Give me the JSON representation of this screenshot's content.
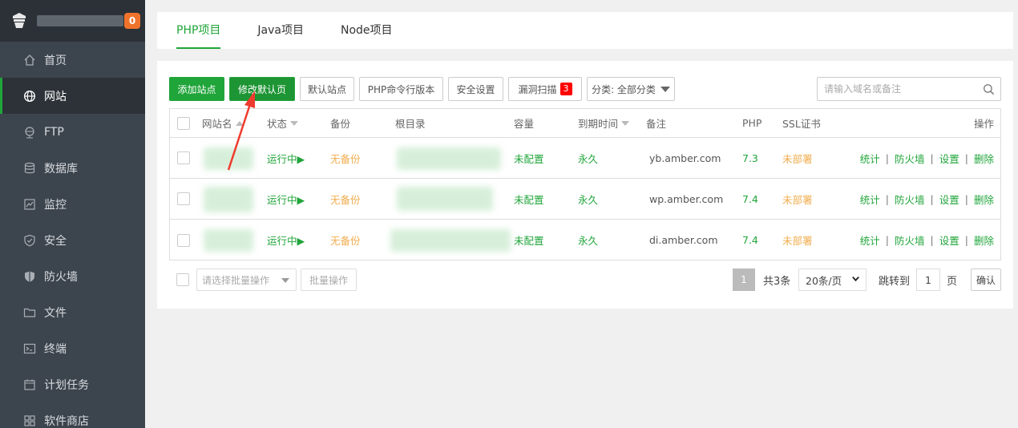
{
  "sidebar": {
    "badge": "0",
    "items": [
      {
        "label": "首页",
        "icon": "home-icon"
      },
      {
        "label": "网站",
        "icon": "globe-icon",
        "active": true
      },
      {
        "label": "FTP",
        "icon": "ftp-icon"
      },
      {
        "label": "数据库",
        "icon": "database-icon"
      },
      {
        "label": "监控",
        "icon": "monitor-icon"
      },
      {
        "label": "安全",
        "icon": "shield-check-icon"
      },
      {
        "label": "防火墙",
        "icon": "firewall-icon"
      },
      {
        "label": "文件",
        "icon": "folder-icon"
      },
      {
        "label": "终端",
        "icon": "terminal-icon"
      },
      {
        "label": "计划任务",
        "icon": "calendar-icon"
      },
      {
        "label": "软件商店",
        "icon": "grid-icon"
      }
    ]
  },
  "tabs": [
    "PHP项目",
    "Java项目",
    "Node项目"
  ],
  "toolbar": {
    "add_site": "添加站点",
    "edit_default_page": "修改默认页",
    "default_site": "默认站点",
    "php_cli_version": "PHP命令行版本",
    "security_settings": "安全设置",
    "vuln_scan": "漏洞扫描",
    "vuln_count": "3",
    "category": "分类: 全部分类"
  },
  "search": {
    "placeholder": "请输入域名或备注"
  },
  "table": {
    "headers": {
      "name": "网站名",
      "status": "状态",
      "backup": "备份",
      "root": "根目录",
      "capacity": "容量",
      "expire": "到期时间",
      "remark": "备注",
      "php": "PHP",
      "ssl": "SSL证书",
      "actions": "操作"
    },
    "rows": [
      {
        "status": "运行中▶",
        "backup": "无备份",
        "capacity": "未配置",
        "expire": "永久",
        "remark": "yb.amber.com",
        "php": "7.3",
        "ssl": "未部署"
      },
      {
        "status": "运行中▶",
        "backup": "无备份",
        "capacity": "未配置",
        "expire": "永久",
        "remark": "wp.amber.com",
        "php": "7.4",
        "ssl": "未部署"
      },
      {
        "status": "运行中▶",
        "backup": "无备份",
        "capacity": "未配置",
        "expire": "永久",
        "remark": "di.amber.com",
        "php": "7.4",
        "ssl": "未部署"
      }
    ],
    "action_labels": {
      "stats": "统计",
      "firewall": "防火墙",
      "settings": "设置",
      "delete": "删除"
    }
  },
  "footer": {
    "batch_placeholder": "请选择批量操作",
    "batch_button": "批量操作",
    "current_page": "1",
    "total": "共3条",
    "page_size": "20条/页",
    "jump_to": "跳转到",
    "jump_value": "1",
    "page_unit": "页",
    "confirm": "确认"
  },
  "colors": {
    "accent": "#20a53a",
    "warning": "#f0ad4e",
    "sidebar_bg": "#3c444d",
    "badge": "#f0732b",
    "danger": "#ff0000"
  }
}
